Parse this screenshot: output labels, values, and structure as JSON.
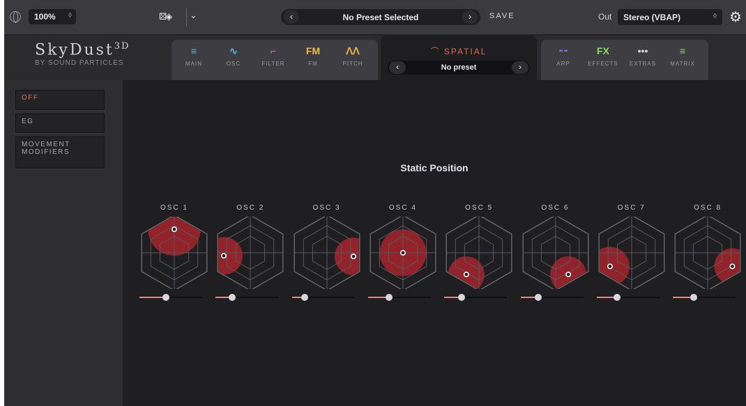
{
  "topbar": {
    "zoom": "100%",
    "preset_name": "No Preset Selected",
    "save_label": "SAVE",
    "out_label": "Out",
    "out_value": "Stereo (VBAP)",
    "prev_glyph": "‹",
    "next_glyph": "›",
    "chevron_glyph": "⌄",
    "stepper_glyph": "◊"
  },
  "header": {
    "logo": "SkyDust",
    "logo_super": "3D",
    "logo_sub": "BY SOUND PARTICLES",
    "nav_left": [
      {
        "icon": "≡",
        "label": "MAIN",
        "color": "#5fb7d8"
      },
      {
        "icon": "∿",
        "label": "OSC",
        "color": "#5fb7d8"
      },
      {
        "icon": "⌐",
        "label": "FILTER",
        "color": "#d878c0"
      },
      {
        "icon": "FM",
        "label": "FM",
        "color": "#f1b94c"
      },
      {
        "icon": "ᐱᐱ",
        "label": "PITCH",
        "color": "#f1b94c"
      }
    ],
    "spatial_title": "SPATIAL",
    "spatial_preset": "No preset",
    "nav_right": [
      {
        "icon": "⁃⁃",
        "label": "ARP",
        "color": "#8a7cf0"
      },
      {
        "icon": "FX",
        "label": "EFFECTS",
        "color": "#8fdc5c"
      },
      {
        "icon": "•••",
        "label": "EXTRAS",
        "color": "#d8d8dc"
      },
      {
        "icon": "≡",
        "label": "MATRIX",
        "color": "#8fdc5c"
      }
    ]
  },
  "sidebar": {
    "items": [
      {
        "label": "OFF",
        "active": true
      },
      {
        "label": "EG",
        "active": false
      },
      {
        "label": "MOVEMENT MODIFIERS",
        "active": false
      }
    ]
  },
  "main": {
    "title": "Static Position",
    "oscillators": [
      {
        "label": "OSC 1",
        "pos": [
          0.0,
          0.78
        ],
        "spread": 0.7,
        "slider": 0.42
      },
      {
        "label": "OSC 2",
        "pos": [
          -0.88,
          -0.1
        ],
        "spread": 0.5,
        "slider": 0.26
      },
      {
        "label": "OSC 3",
        "pos": [
          0.88,
          -0.12
        ],
        "spread": 0.5,
        "slider": 0.21
      },
      {
        "label": "OSC 4",
        "pos": [
          0.0,
          0.0
        ],
        "spread": 0.62,
        "slider": 0.33
      },
      {
        "label": "OSC 5",
        "pos": [
          -0.42,
          -0.72
        ],
        "spread": 0.48,
        "slider": 0.28
      },
      {
        "label": "OSC 6",
        "pos": [
          0.42,
          -0.72
        ],
        "spread": 0.48,
        "slider": 0.28
      },
      {
        "label": "OSC 7",
        "pos": [
          -0.72,
          -0.45
        ],
        "spread": 0.52,
        "slider": 0.33
      },
      {
        "label": "OSC 8",
        "pos": [
          0.82,
          -0.45
        ],
        "spread": 0.48,
        "slider": 0.33
      }
    ],
    "colors": {
      "sound_fill": "#a8242c",
      "accent": "#e36e5e",
      "grid": "#5a5a5e"
    }
  }
}
